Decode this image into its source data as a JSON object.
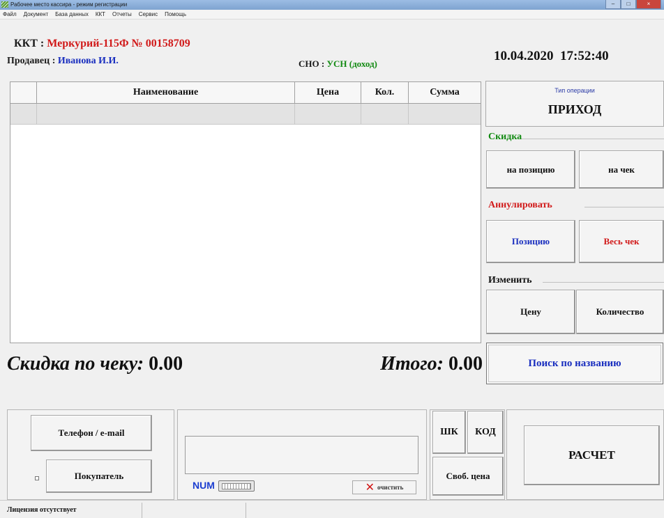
{
  "window": {
    "title": "Рабочее место кассира - режим регистрации",
    "controls": [
      "–",
      "□",
      "×"
    ]
  },
  "menu": [
    "Файл",
    "Документ",
    "База данных",
    "ККТ",
    "Отчеты",
    "Сервис",
    "Помощь"
  ],
  "header": {
    "kkt_label": "ККТ :",
    "kkt_value": "Меркурий-115Ф  № 00158709",
    "seller_label": "Продавец :",
    "seller_value": "Иванова И.И.",
    "sno_label": "СНО :",
    "sno_value": "УСН (доход)",
    "date": "10.04.2020",
    "time": "17:52:40"
  },
  "grid": {
    "columns": [
      "",
      "Наименование",
      "Цена",
      "Кол.",
      "Сумма"
    ],
    "rows": []
  },
  "totals": {
    "discount_label": "Скидка по чеку:",
    "discount_value": "0.00",
    "total_label": "Итого:",
    "total_value": "0.00"
  },
  "operation": {
    "label": "Тип операции",
    "value": "ПРИХОД"
  },
  "discount_section": {
    "label": "Скидка",
    "per_item": "на позицию",
    "per_check": "на чек"
  },
  "cancel_section": {
    "label": "Аннулировать",
    "item": "Позицию",
    "whole": "Весь чек"
  },
  "change_section": {
    "label": "Изменить",
    "price": "Цену",
    "quantity": "Количество"
  },
  "search_button": "Поиск по названию",
  "bottom": {
    "phone_email": "Телефон / e-mail",
    "buyer": "Покупатель",
    "num": "NUM",
    "clear": "очистить",
    "barcode": "ШК",
    "code": "КОД",
    "free_price": "Своб. цена",
    "pay": "РАСЧЕТ"
  },
  "status": {
    "license": "Лицензия отсутствует"
  },
  "colors": {
    "red": "#d11a1a",
    "blue": "#1a2fbf",
    "green": "#128a12"
  }
}
